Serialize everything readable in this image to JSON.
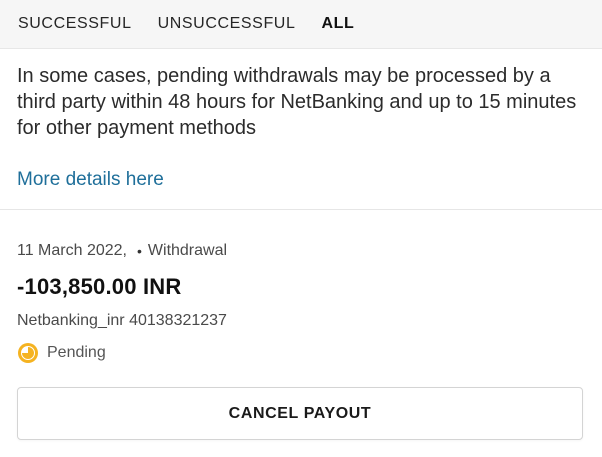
{
  "tabs": [
    {
      "label": "SUCCESSFUL",
      "active": false
    },
    {
      "label": "UNSUCCESSFUL",
      "active": false
    },
    {
      "label": "ALL",
      "active": true
    }
  ],
  "notice": {
    "text": "In some cases, pending withdrawals may be processed by a third party within 48 hours for NetBanking and up to 15 minutes for other payment methods",
    "link_label": "More details here"
  },
  "transaction": {
    "date": "11 March 2022,",
    "bullet": "•",
    "type": "Withdrawal",
    "amount": "-103,850.00 INR",
    "method": "Netbanking_inr 40138321237",
    "status": "Pending",
    "status_icon": "pending-clock-icon",
    "cancel_label": "CANCEL PAYOUT"
  },
  "colors": {
    "tab_bar_bg": "#f6f6f6",
    "link": "#1f6f9a",
    "pending_icon": "#f5b321"
  }
}
